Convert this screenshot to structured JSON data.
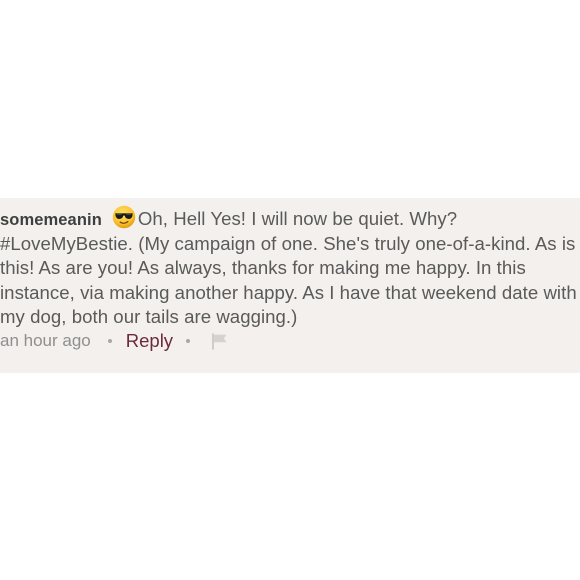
{
  "comment": {
    "username": "somemeanin",
    "emoji_icon": "sunglasses-face-icon",
    "text": "Oh, Hell Yes! I will now be quiet. Why? #LoveMyBestie. (My campaign of one. She's truly one-of-a-kind. As is this! As are you! As always, thanks for making me happy. In this instance, via making another happy. As I have that weekend date with my dog, both our tails are wagging.)",
    "timestamp": "an hour ago",
    "reply_label": "Reply",
    "flag_icon": "flag-icon"
  },
  "colors": {
    "card_background": "#f3f0ed",
    "username": "#3f3f3f",
    "body_text": "#5a5a5a",
    "meta_text": "#8f8f8f",
    "reply_link": "#6d2a3e"
  }
}
